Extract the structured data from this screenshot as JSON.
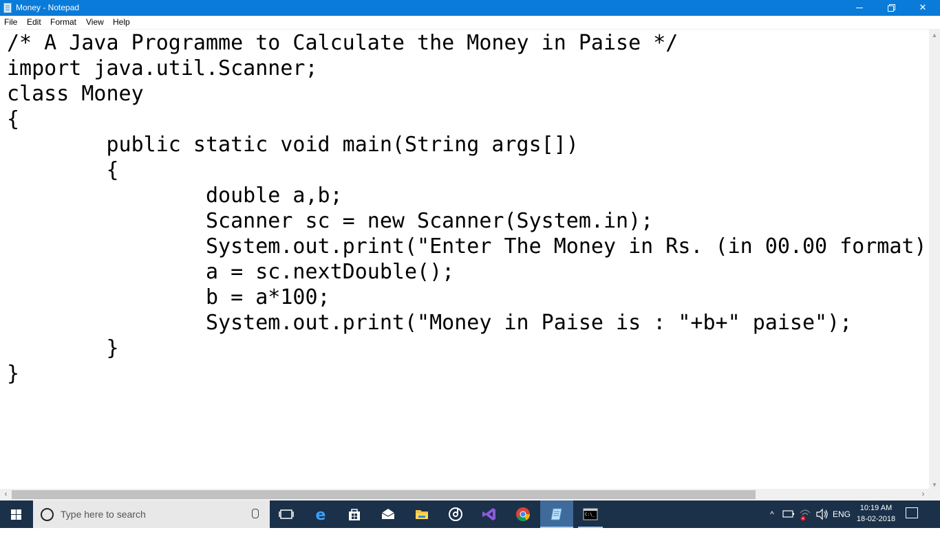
{
  "window": {
    "title": "Money - Notepad",
    "controls": {
      "minimize": "─",
      "restore": "",
      "close": "✕"
    }
  },
  "menu": {
    "items": [
      "File",
      "Edit",
      "Format",
      "View",
      "Help"
    ]
  },
  "editor": {
    "lines": [
      "/* A Java Programme to Calculate the Money in Paise */",
      "import java.util.Scanner;",
      "class Money",
      "{",
      "        public static void main(String args[])",
      "        {",
      "                double a,b;",
      "                Scanner sc = new Scanner(System.in);",
      "                System.out.print(\"Enter The Money in Rs. (in 00.00 format)",
      "                a = sc.nextDouble();",
      "                b = a*100;",
      "                System.out.print(\"Money in Paise is : \"+b+\" paise\");",
      "        }",
      "}"
    ]
  },
  "scrollbars": {
    "left_arrow": "‹",
    "right_arrow": "›",
    "up_arrow": "▲",
    "down_arrow": "▼"
  },
  "taskbar": {
    "search_placeholder": "Type here to search",
    "icons": [
      "task-view",
      "edge",
      "store",
      "mail",
      "file-explorer",
      "groove",
      "visual-studio",
      "chrome",
      "notepad",
      "command-prompt"
    ],
    "tray": {
      "language": "ENG",
      "time": "10:19 AM",
      "date": "18-02-2018"
    }
  },
  "colors": {
    "titlebar": "#0a7bd8",
    "taskbar": "#1b3049"
  }
}
